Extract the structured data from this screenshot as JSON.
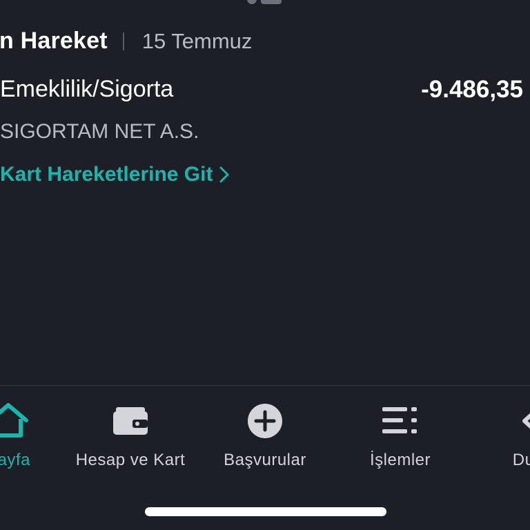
{
  "section": {
    "title": "on Hareket",
    "date": "15 Temmuz"
  },
  "transaction": {
    "category": "Emeklilik/Sigorta",
    "amount": "-9.486,35",
    "merchant": "SIGORTAM NET A.S.",
    "link_label": "Kart Hareketlerine Git"
  },
  "tabbar": {
    "tabs": [
      {
        "label": "Sayfa",
        "icon": "home-icon",
        "active": true
      },
      {
        "label": "Hesap ve Kart",
        "icon": "wallet-icon",
        "active": false
      },
      {
        "label": "Başvurular",
        "icon": "plus-circle-icon",
        "active": false
      },
      {
        "label": "İşlemler",
        "icon": "list-icon",
        "active": false
      },
      {
        "label": "Durum",
        "icon": "status-icon",
        "active": false
      }
    ]
  },
  "colors": {
    "background": "#1c1f26",
    "accent": "#1ab6ae",
    "text_primary": "#ffffff",
    "text_secondary": "#b9bcc3"
  }
}
